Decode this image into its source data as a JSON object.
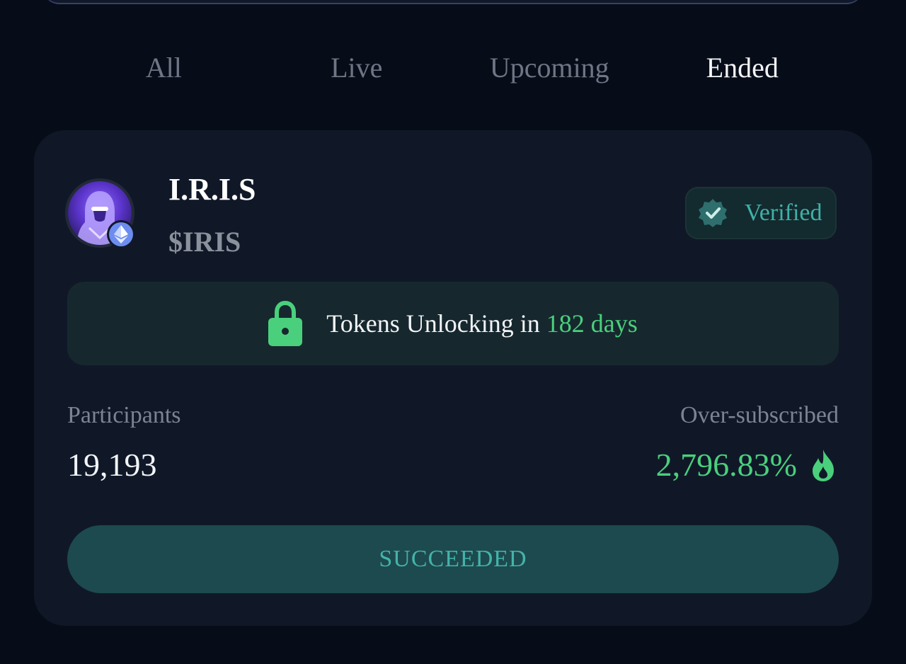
{
  "tabs": [
    {
      "label": "All",
      "active": false
    },
    {
      "label": "Live",
      "active": false
    },
    {
      "label": "Upcoming",
      "active": false
    },
    {
      "label": "Ended",
      "active": true
    }
  ],
  "project": {
    "name": "I.R.I.S",
    "symbol": "$IRIS",
    "chain_icon": "ethereum-icon",
    "avatar_icon": "hooded-figure-avatar",
    "verified_label": "Verified"
  },
  "unlock": {
    "prefix": "Tokens Unlocking in ",
    "days": "182 days",
    "icon": "lock-icon"
  },
  "stats": {
    "participants_label": "Participants",
    "participants_value": "19,193",
    "oversubscribed_label": "Over-subscribed",
    "oversubscribed_value": "2,796.83%",
    "oversubscribed_icon": "flame-icon"
  },
  "status_button": "SUCCEEDED",
  "colors": {
    "background": "#070d18",
    "card": "#101828",
    "accent_green": "#4ad07c",
    "accent_teal": "#3fb1a7",
    "button_bg": "#1d4a4e"
  }
}
